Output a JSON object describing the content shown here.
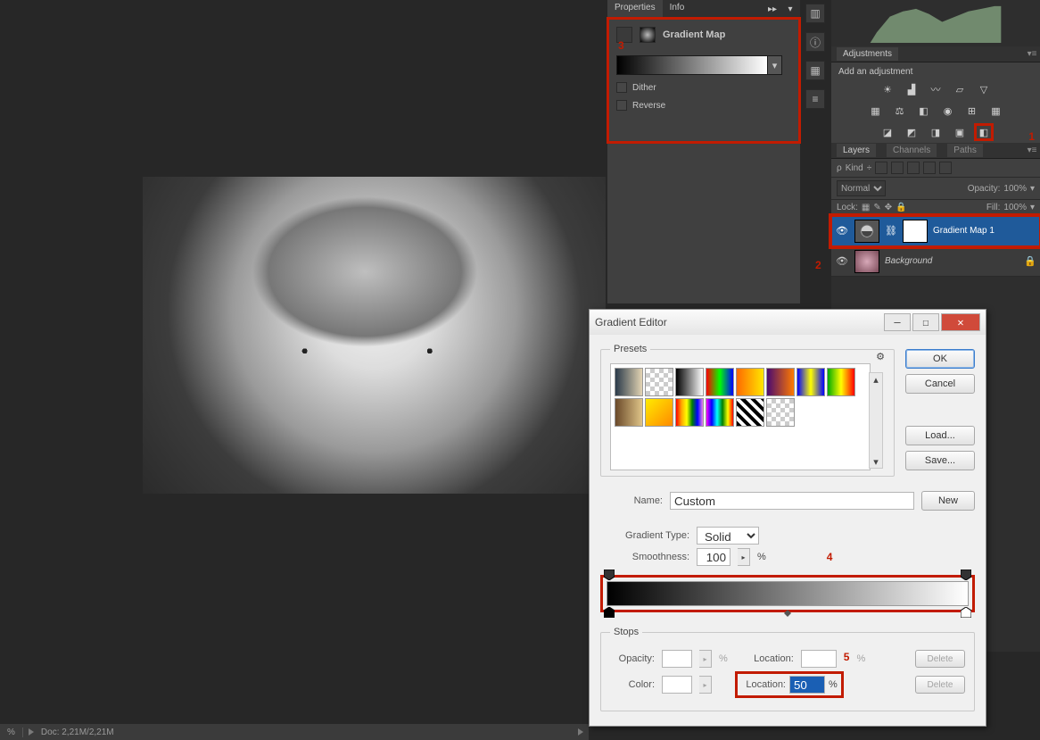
{
  "canvas": {
    "doc_stat": "Doc: 2,21M/2,21M",
    "zoom": "%"
  },
  "properties_panel": {
    "tabs": {
      "properties": "Properties",
      "info": "Info"
    },
    "title": "Gradient Map",
    "dither": "Dither",
    "reverse": "Reverse",
    "annotation": "3"
  },
  "adjustments_panel": {
    "tab": "Adjustments",
    "title": "Add an adjustment",
    "annotation": "1"
  },
  "layers_panel": {
    "tabs": {
      "layers": "Layers",
      "channels": "Channels",
      "paths": "Paths"
    },
    "kind": "Kind",
    "blend_mode": "Normal",
    "opacity_label": "Opacity:",
    "opacity_value": "100%",
    "lock_label": "Lock:",
    "fill_label": "Fill:",
    "fill_value": "100%",
    "layer1": "Gradient Map 1",
    "layer2": "Background",
    "annotation": "2"
  },
  "gradient_editor": {
    "title": "Gradient Editor",
    "presets_label": "Presets",
    "buttons": {
      "ok": "OK",
      "cancel": "Cancel",
      "load": "Load...",
      "save": "Save...",
      "new": "New",
      "delete": "Delete"
    },
    "name_label": "Name:",
    "name_value": "Custom",
    "type_label": "Gradient Type:",
    "type_value": "Solid",
    "smooth_label": "Smoothness:",
    "smooth_value": "100",
    "percent": "%",
    "stops_label": "Stops",
    "opacity_label": "Opacity:",
    "location_label": "Location:",
    "color_label": "Color:",
    "location_value": "50",
    "annotation4": "4",
    "annotation5": "5"
  }
}
